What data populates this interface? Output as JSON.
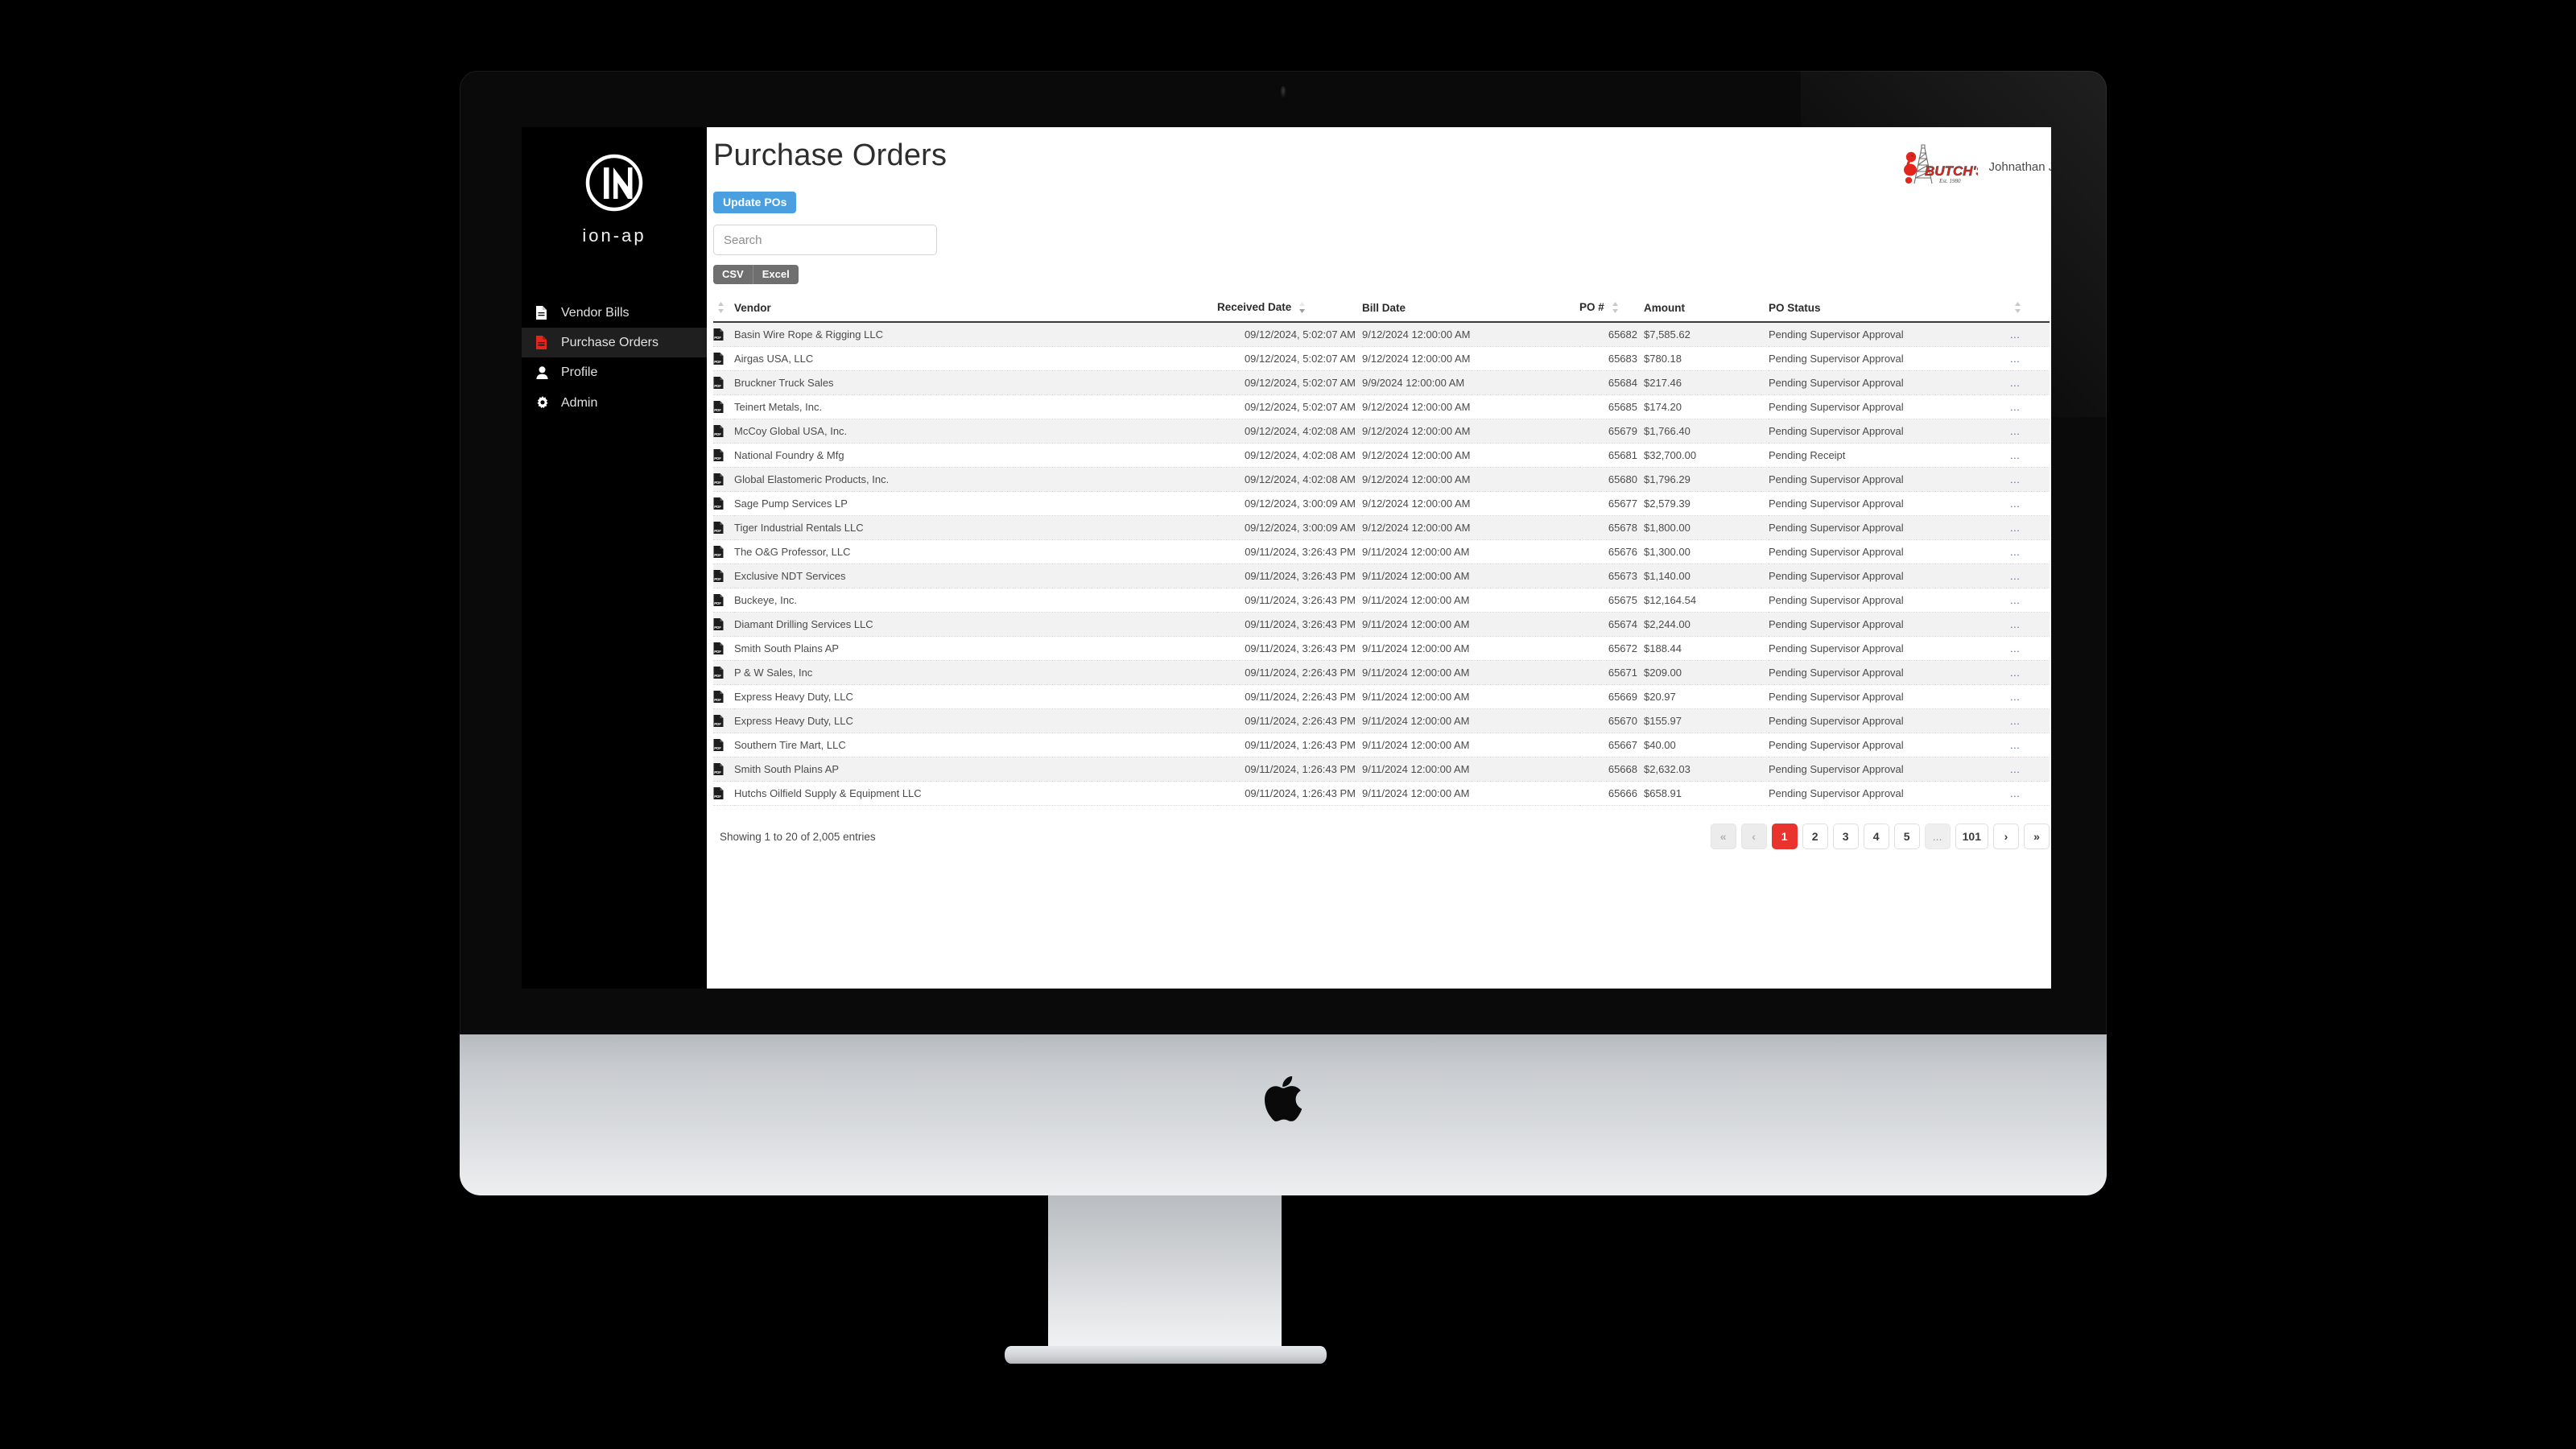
{
  "brand": {
    "logo_icon": "ion-ap-circle-logo",
    "name": "ion-ap"
  },
  "sidebar": {
    "items": [
      {
        "label": "Vendor Bills",
        "icon": "file-icon",
        "active": false
      },
      {
        "label": "Purchase Orders",
        "icon": "file-icon-red",
        "active": true
      },
      {
        "label": "Profile",
        "icon": "user-icon",
        "active": false
      },
      {
        "label": "Admin",
        "icon": "gear-icon",
        "active": false
      }
    ]
  },
  "header": {
    "title": "Purchase Orders",
    "company_logo_icon": "butchs-logo",
    "company_logo_text": "BUTCH'S",
    "company_logo_sub": "Est. 1980",
    "user": "Johnathan Johnson : Adm"
  },
  "toolbar": {
    "update_label": "Update POs",
    "search_placeholder": "Search",
    "search_value": "",
    "export": [
      {
        "label": "CSV"
      },
      {
        "label": "Excel"
      }
    ]
  },
  "table": {
    "columns": [
      {
        "label": "",
        "key": "pdf",
        "sortable": true,
        "align": "left"
      },
      {
        "label": "Vendor",
        "key": "vendor",
        "sortable": true,
        "align": "left"
      },
      {
        "label": "Received Date",
        "key": "received",
        "sortable": true,
        "align": "right",
        "sorted": "desc"
      },
      {
        "label": "Bill Date",
        "key": "bill",
        "sortable": true,
        "align": "left"
      },
      {
        "label": "PO #",
        "key": "po",
        "sortable": true,
        "align": "right"
      },
      {
        "label": "Amount",
        "key": "amount",
        "sortable": true,
        "align": "left"
      },
      {
        "label": "PO Status",
        "key": "status",
        "sortable": true,
        "align": "left"
      },
      {
        "label": "",
        "key": "detail",
        "sortable": true,
        "align": "left"
      }
    ],
    "detail_link_label": "...",
    "rows": [
      {
        "vendor": "Basin Wire Rope & Rigging LLC",
        "received": "09/12/2024, 5:02:07 AM",
        "bill": "9/12/2024 12:00:00 AM",
        "po": "65682",
        "amount": "$7,585.62",
        "status": "Pending Supervisor Approval"
      },
      {
        "vendor": "Airgas USA, LLC",
        "received": "09/12/2024, 5:02:07 AM",
        "bill": "9/12/2024 12:00:00 AM",
        "po": "65683",
        "amount": "$780.18",
        "status": "Pending Supervisor Approval"
      },
      {
        "vendor": "Bruckner Truck Sales",
        "received": "09/12/2024, 5:02:07 AM",
        "bill": "9/9/2024 12:00:00 AM",
        "po": "65684",
        "amount": "$217.46",
        "status": "Pending Supervisor Approval"
      },
      {
        "vendor": "Teinert Metals, Inc.",
        "received": "09/12/2024, 5:02:07 AM",
        "bill": "9/12/2024 12:00:00 AM",
        "po": "65685",
        "amount": "$174.20",
        "status": "Pending Supervisor Approval"
      },
      {
        "vendor": "McCoy Global USA, Inc.",
        "received": "09/12/2024, 4:02:08 AM",
        "bill": "9/12/2024 12:00:00 AM",
        "po": "65679",
        "amount": "$1,766.40",
        "status": "Pending Supervisor Approval"
      },
      {
        "vendor": "National Foundry & Mfg",
        "received": "09/12/2024, 4:02:08 AM",
        "bill": "9/12/2024 12:00:00 AM",
        "po": "65681",
        "amount": "$32,700.00",
        "status": "Pending Receipt"
      },
      {
        "vendor": "Global Elastomeric Products, Inc.",
        "received": "09/12/2024, 4:02:08 AM",
        "bill": "9/12/2024 12:00:00 AM",
        "po": "65680",
        "amount": "$1,796.29",
        "status": "Pending Supervisor Approval"
      },
      {
        "vendor": "Sage Pump Services LP",
        "received": "09/12/2024, 3:00:09 AM",
        "bill": "9/12/2024 12:00:00 AM",
        "po": "65677",
        "amount": "$2,579.39",
        "status": "Pending Supervisor Approval"
      },
      {
        "vendor": "Tiger Industrial Rentals LLC",
        "received": "09/12/2024, 3:00:09 AM",
        "bill": "9/12/2024 12:00:00 AM",
        "po": "65678",
        "amount": "$1,800.00",
        "status": "Pending Supervisor Approval"
      },
      {
        "vendor": "The O&G Professor, LLC",
        "received": "09/11/2024, 3:26:43 PM",
        "bill": "9/11/2024 12:00:00 AM",
        "po": "65676",
        "amount": "$1,300.00",
        "status": "Pending Supervisor Approval"
      },
      {
        "vendor": "Exclusive NDT Services",
        "received": "09/11/2024, 3:26:43 PM",
        "bill": "9/11/2024 12:00:00 AM",
        "po": "65673",
        "amount": "$1,140.00",
        "status": "Pending Supervisor Approval"
      },
      {
        "vendor": "Buckeye, Inc.",
        "received": "09/11/2024, 3:26:43 PM",
        "bill": "9/11/2024 12:00:00 AM",
        "po": "65675",
        "amount": "$12,164.54",
        "status": "Pending Supervisor Approval"
      },
      {
        "vendor": "Diamant Drilling Services LLC",
        "received": "09/11/2024, 3:26:43 PM",
        "bill": "9/11/2024 12:00:00 AM",
        "po": "65674",
        "amount": "$2,244.00",
        "status": "Pending Supervisor Approval"
      },
      {
        "vendor": "Smith South Plains AP",
        "received": "09/11/2024, 3:26:43 PM",
        "bill": "9/11/2024 12:00:00 AM",
        "po": "65672",
        "amount": "$188.44",
        "status": "Pending Supervisor Approval"
      },
      {
        "vendor": "P & W Sales, Inc",
        "received": "09/11/2024, 2:26:43 PM",
        "bill": "9/11/2024 12:00:00 AM",
        "po": "65671",
        "amount": "$209.00",
        "status": "Pending Supervisor Approval"
      },
      {
        "vendor": "Express Heavy Duty, LLC",
        "received": "09/11/2024, 2:26:43 PM",
        "bill": "9/11/2024 12:00:00 AM",
        "po": "65669",
        "amount": "$20.97",
        "status": "Pending Supervisor Approval"
      },
      {
        "vendor": "Express Heavy Duty, LLC",
        "received": "09/11/2024, 2:26:43 PM",
        "bill": "9/11/2024 12:00:00 AM",
        "po": "65670",
        "amount": "$155.97",
        "status": "Pending Supervisor Approval"
      },
      {
        "vendor": "Southern Tire Mart, LLC",
        "received": "09/11/2024, 1:26:43 PM",
        "bill": "9/11/2024 12:00:00 AM",
        "po": "65667",
        "amount": "$40.00",
        "status": "Pending Supervisor Approval"
      },
      {
        "vendor": "Smith South Plains AP",
        "received": "09/11/2024, 1:26:43 PM",
        "bill": "9/11/2024 12:00:00 AM",
        "po": "65668",
        "amount": "$2,632.03",
        "status": "Pending Supervisor Approval"
      },
      {
        "vendor": "Hutchs Oilfield Supply & Equipment LLC",
        "received": "09/11/2024, 1:26:43 PM",
        "bill": "9/11/2024 12:00:00 AM",
        "po": "65666",
        "amount": "$658.91",
        "status": "Pending Supervisor Approval"
      }
    ]
  },
  "footer": {
    "showing": "Showing 1 to 20 of 2,005 entries",
    "pagination": [
      {
        "label": "«",
        "state": "disabled",
        "name": "first"
      },
      {
        "label": "‹",
        "state": "disabled",
        "name": "previous"
      },
      {
        "label": "1",
        "state": "active",
        "name": "page-1"
      },
      {
        "label": "2",
        "state": "normal",
        "name": "page-2"
      },
      {
        "label": "3",
        "state": "normal",
        "name": "page-3"
      },
      {
        "label": "4",
        "state": "normal",
        "name": "page-4"
      },
      {
        "label": "5",
        "state": "normal",
        "name": "page-5"
      },
      {
        "label": "...",
        "state": "ellipsis",
        "name": "gap"
      },
      {
        "label": "101",
        "state": "normal",
        "name": "page-101"
      },
      {
        "label": "›",
        "state": "normal",
        "name": "next"
      },
      {
        "label": "»",
        "state": "normal",
        "name": "last"
      }
    ]
  },
  "colors": {
    "accent_blue": "#4a9fe0",
    "accent_red": "#e8342c",
    "sidebar_bg": "#000000",
    "row_alt": "#f2f2f2"
  }
}
